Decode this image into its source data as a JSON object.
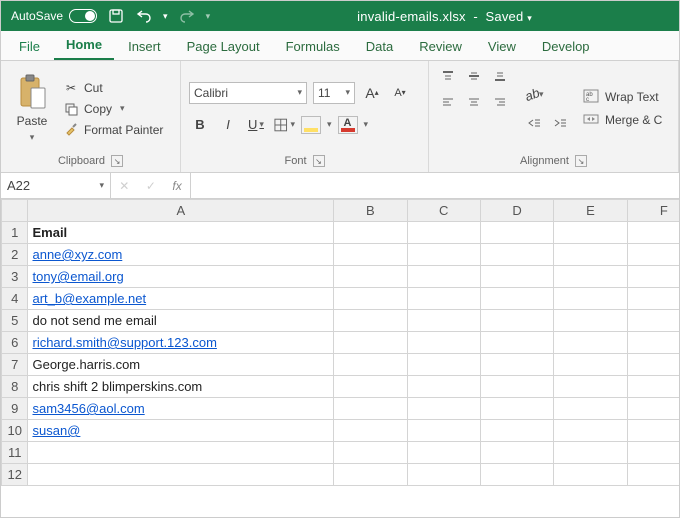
{
  "title": {
    "autosave_label": "AutoSave",
    "autosave_state": "Off",
    "doc_name": "invalid-emails.xlsx",
    "doc_state": "Saved"
  },
  "tabs": {
    "file": "File",
    "home": "Home",
    "insert": "Insert",
    "page_layout": "Page Layout",
    "formulas": "Formulas",
    "data": "Data",
    "review": "Review",
    "view": "View",
    "developer": "Develop"
  },
  "ribbon": {
    "clipboard": {
      "paste": "Paste",
      "cut": "Cut",
      "copy": "Copy",
      "format_painter": "Format Painter",
      "group_label": "Clipboard"
    },
    "font": {
      "font_name": "Calibri",
      "font_size": "11",
      "group_label": "Font",
      "bold": "B",
      "italic": "I",
      "underline": "U"
    },
    "alignment": {
      "wrap": "Wrap Text",
      "merge": "Merge & C",
      "group_label": "Alignment"
    }
  },
  "formula_bar": {
    "name_box": "A22",
    "fx_label": "fx",
    "value": ""
  },
  "sheet": {
    "columns": [
      "A",
      "B",
      "C",
      "D",
      "E",
      "F"
    ],
    "rows": [
      {
        "n": 1,
        "a": "Email",
        "link": false,
        "bold": true
      },
      {
        "n": 2,
        "a": "anne@xyz.com",
        "link": true
      },
      {
        "n": 3,
        "a": "tony@email.org",
        "link": true
      },
      {
        "n": 4,
        "a": "art_b@example.net",
        "link": true
      },
      {
        "n": 5,
        "a": "do not send me email",
        "link": false
      },
      {
        "n": 6,
        "a": "richard.smith@support.123.com",
        "link": true
      },
      {
        "n": 7,
        "a": "George.harris.com",
        "link": false
      },
      {
        "n": 8,
        "a": "chris shift 2 blimperskins.com",
        "link": false
      },
      {
        "n": 9,
        "a": "sam3456@aol.com",
        "link": true
      },
      {
        "n": 10,
        "a": "susan@",
        "link": true
      },
      {
        "n": 11,
        "a": "",
        "link": false
      },
      {
        "n": 12,
        "a": "",
        "link": false
      }
    ]
  }
}
